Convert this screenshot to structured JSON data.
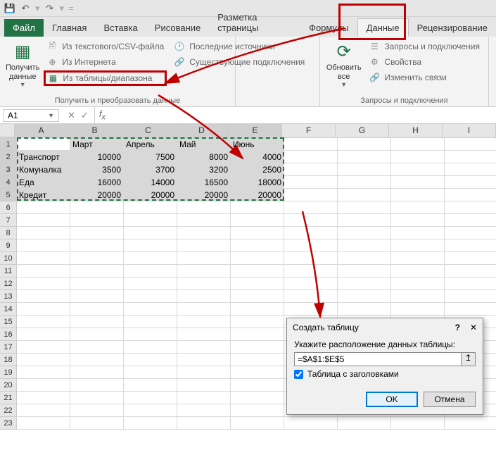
{
  "qat": {
    "save": "save",
    "undo": "undo",
    "redo": "redo"
  },
  "tabs": {
    "file": "Файл",
    "home": "Главная",
    "insert": "Вставка",
    "draw": "Рисование",
    "layout": "Разметка страницы",
    "formulas": "Формулы",
    "data": "Данные",
    "review": "Рецензирование"
  },
  "ribbon": {
    "get_data": {
      "label": "Получить\nданные"
    },
    "refresh_all": {
      "label": "Обновить\nвсе"
    },
    "group1": {
      "from_csv": "Из текстового/CSV-файла",
      "from_web": "Из Интернета",
      "from_table": "Из таблицы/диапазона",
      "recent": "Последние источники",
      "existing": "Существующие подключения",
      "title": "Получить и преобразовать данные"
    },
    "group2": {
      "queries": "Запросы и подключения",
      "props": "Свойства",
      "links": "Изменить связи",
      "title": "Запросы и подключения"
    }
  },
  "namebox": {
    "value": "A1"
  },
  "columns": [
    "A",
    "B",
    "C",
    "D",
    "E",
    "F",
    "G",
    "H",
    "I"
  ],
  "sheet": {
    "headers": [
      "",
      "Март",
      "Апрель",
      "Май",
      "Июнь"
    ],
    "rows": [
      {
        "label": "Транспорт",
        "vals": [
          "10000",
          "7500",
          "8000",
          "4000"
        ]
      },
      {
        "label": "Комуналка",
        "vals": [
          "3500",
          "3700",
          "3200",
          "2500"
        ]
      },
      {
        "label": "Еда",
        "vals": [
          "16000",
          "14000",
          "16500",
          "18000"
        ]
      },
      {
        "label": "Кредит",
        "vals": [
          "20000",
          "20000",
          "20000",
          "20000"
        ]
      }
    ]
  },
  "dialog": {
    "title": "Создать таблицу",
    "prompt": "Укажите расположение данных таблицы:",
    "range": "=$A$1:$E$5",
    "checkbox": "Таблица с заголовками",
    "ok": "OK",
    "cancel": "Отмена"
  }
}
